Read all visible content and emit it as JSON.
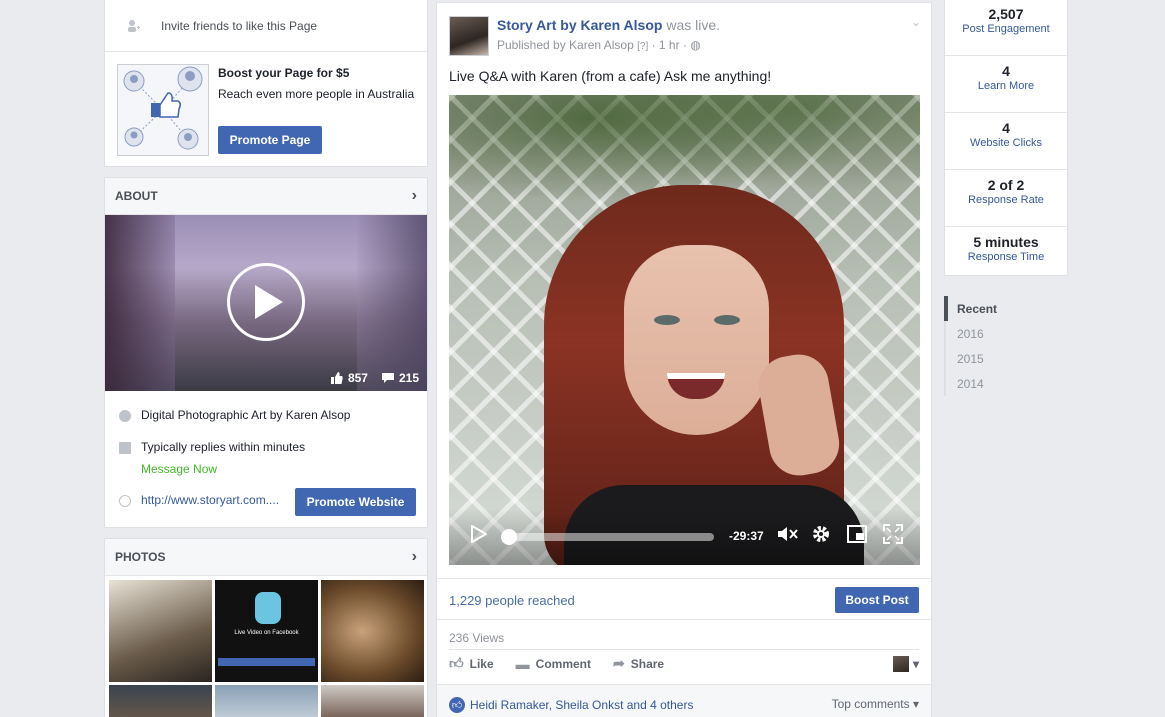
{
  "invite": {
    "label": "Invite friends to like this Page",
    "icon": "add-friend-icon"
  },
  "boost": {
    "title": "Boost your Page for $5",
    "subtitle": "Reach even more people in Australia",
    "button": "Promote Page"
  },
  "about": {
    "heading": "ABOUT",
    "likes_count": "857",
    "comments_count": "215",
    "description": "Digital Photographic Art by Karen Alsop",
    "replies": "Typically replies within minutes",
    "message_now": "Message Now",
    "website": "http://www.storyart.com....",
    "promote_button": "Promote Website"
  },
  "photos": {
    "heading": "PHOTOS",
    "tile_caption": "Live Video on Facebook"
  },
  "post": {
    "page_name": "Story Art by Karen Alsop",
    "status": "was live.",
    "published_by": "Published by Karen Alsop",
    "help": "[?]",
    "time": "1 hr",
    "text": "Live Q&A with Karen (from a cafe) Ask me anything!",
    "video_time": "-29:37",
    "progress": 0.0,
    "reach": "1,229 people reached",
    "boost_button": "Boost Post",
    "views": "236 Views",
    "actions": {
      "like": "Like",
      "comment": "Comment",
      "share": "Share"
    },
    "likers": "Heidi Ramaker, Sheila Onkst and 4 others",
    "top_comments": "Top comments"
  },
  "insights": [
    {
      "value": "2,507",
      "label": "Post Engagement"
    },
    {
      "value": "4",
      "label": "Learn More"
    },
    {
      "value": "4",
      "label": "Website Clicks"
    },
    {
      "value": "2 of 2",
      "label": "Response Rate"
    },
    {
      "value": "5 minutes",
      "label": "Response Time"
    }
  ],
  "timeline": [
    "Recent",
    "2016",
    "2015",
    "2014"
  ],
  "colors": {
    "fb_blue": "#4267b2",
    "link": "#365899",
    "green": "#42b72a",
    "bg": "#e9ebee"
  }
}
